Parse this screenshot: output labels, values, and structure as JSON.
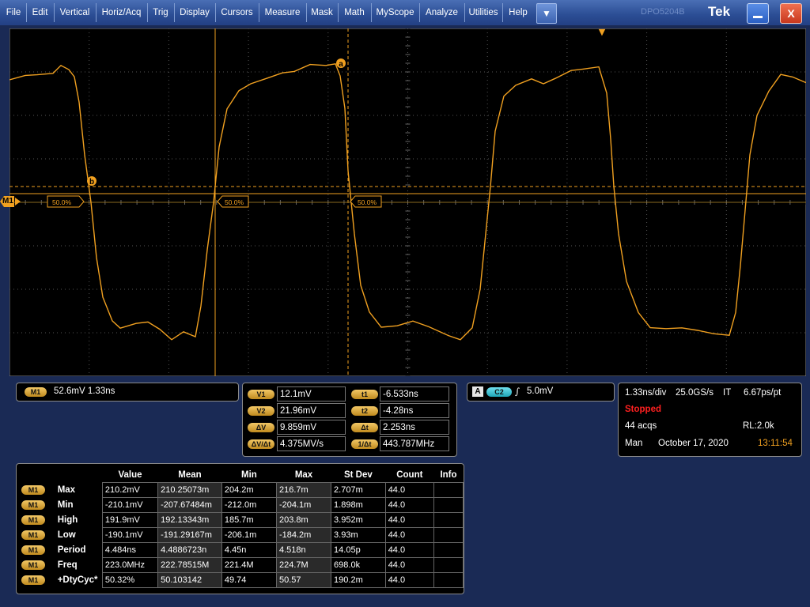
{
  "menu": [
    "File",
    "Edit",
    "Vertical",
    "Horiz/Acq",
    "Trig",
    "Display",
    "Cursors",
    "Measure",
    "Mask",
    "Math",
    "MyScope",
    "Analyze",
    "Utilities",
    "Help"
  ],
  "menu_dropdown": "▼",
  "title_faded": "DPO5204B",
  "brand": "Tek",
  "close_label": "X",
  "screen": {
    "cursor_a_label": "a",
    "cursor_b_label": "b",
    "ref_marker": "M1",
    "trigger_marker": "▼",
    "level_markers": [
      "50.0%",
      "50.0%",
      "50.0%"
    ],
    "waveform_color": "#f0a020"
  },
  "scale_box": {
    "channel": "M1",
    "text": "52.6mV  1.33ns"
  },
  "cursors": {
    "rows": [
      {
        "label": "V1",
        "value": "12.1mV",
        "label2": "t1",
        "value2": "-6.533ns"
      },
      {
        "label": "V2",
        "value": "21.96mV",
        "label2": "t2",
        "value2": "-4.28ns"
      },
      {
        "label": "ΔV",
        "value": "9.859mV",
        "label2": "Δt",
        "value2": "2.253ns"
      },
      {
        "label": "ΔV/Δt",
        "value": "4.375MV/s",
        "label2": "1/Δt",
        "value2": "443.787MHz"
      }
    ]
  },
  "trigger_box": {
    "mode": "A",
    "channel": "C2",
    "slope": "∫",
    "level": "5.0mV"
  },
  "acq_box": {
    "timebase": "1.33ns/div",
    "rate": "25.0GS/s",
    "mode": "IT",
    "resolution": "6.67ps/pt",
    "status": "Stopped",
    "acqs": "44 acqs",
    "record": "RL:2.0k",
    "trig_mode": "Man",
    "date": "October 17, 2020",
    "time": "13:11:54"
  },
  "measurements": {
    "headers": [
      "Value",
      "Mean",
      "Min",
      "Max",
      "St Dev",
      "Count",
      "Info"
    ],
    "rows": [
      {
        "ch": "M1",
        "name": "Max",
        "cells": [
          "210.2mV",
          "210.25073m",
          "204.2m",
          "216.7m",
          "2.707m",
          "44.0",
          ""
        ]
      },
      {
        "ch": "M1",
        "name": "Min",
        "cells": [
          "-210.1mV",
          "-207.67484m",
          "-212.0m",
          "-204.1m",
          "1.898m",
          "44.0",
          ""
        ]
      },
      {
        "ch": "M1",
        "name": "High",
        "cells": [
          "191.9mV",
          "192.13343m",
          "185.7m",
          "203.8m",
          "3.952m",
          "44.0",
          ""
        ]
      },
      {
        "ch": "M1",
        "name": "Low",
        "cells": [
          "-190.1mV",
          "-191.29167m",
          "-206.1m",
          "-184.2m",
          "3.93m",
          "44.0",
          ""
        ]
      },
      {
        "ch": "M1",
        "name": "Period",
        "cells": [
          "4.484ns",
          "4.4886723n",
          "4.45n",
          "4.518n",
          "14.05p",
          "44.0",
          ""
        ]
      },
      {
        "ch": "M1",
        "name": "Freq",
        "cells": [
          "223.0MHz",
          "222.78515M",
          "221.4M",
          "224.7M",
          "698.0k",
          "44.0",
          ""
        ]
      },
      {
        "ch": "M1",
        "name": "+DtyCyc*",
        "cells": [
          "50.32%",
          "50.103142",
          "49.74",
          "50.57",
          "190.2m",
          "44.0",
          ""
        ]
      }
    ]
  }
}
